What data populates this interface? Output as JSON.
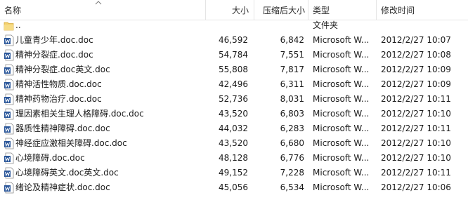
{
  "columns": {
    "name": "名称",
    "size": "大小",
    "compressed": "压缩后大小",
    "type": "类型",
    "modified": "修改时间"
  },
  "parent_row": {
    "name": "..",
    "type": "文件夹",
    "icon": "folder-icon"
  },
  "files": [
    {
      "name": "儿童青少年.doc.doc",
      "size": "46,592",
      "compressed": "6,842",
      "type": "Microsoft W...",
      "modified": "2012/2/27 10:07",
      "icon": "word-document-icon"
    },
    {
      "name": "精神分裂症.doc.doc",
      "size": "54,784",
      "compressed": "7,551",
      "type": "Microsoft W...",
      "modified": "2012/2/27 10:08",
      "icon": "word-document-icon"
    },
    {
      "name": "精神分裂症.doc英文.doc",
      "size": "55,808",
      "compressed": "7,817",
      "type": "Microsoft W...",
      "modified": "2012/2/27 10:09",
      "icon": "word-document-icon"
    },
    {
      "name": "精神活性物质.doc.doc",
      "size": "42,496",
      "compressed": "6,311",
      "type": "Microsoft W...",
      "modified": "2012/2/27 10:09",
      "icon": "word-document-icon"
    },
    {
      "name": "精神药物治疗.doc.doc",
      "size": "52,736",
      "compressed": "8,031",
      "type": "Microsoft W...",
      "modified": "2012/2/27 10:11",
      "icon": "word-document-icon"
    },
    {
      "name": "理因素相关生理人格障碍.doc.doc",
      "size": "43,520",
      "compressed": "6,803",
      "type": "Microsoft W...",
      "modified": "2012/2/27 10:10",
      "icon": "word-document-icon"
    },
    {
      "name": "器质性精神障碍.doc.doc",
      "size": "44,032",
      "compressed": "6,283",
      "type": "Microsoft W...",
      "modified": "2012/2/27 10:11",
      "icon": "word-document-icon"
    },
    {
      "name": "神经症应激相关障碍.doc.doc",
      "size": "43,520",
      "compressed": "6,680",
      "type": "Microsoft W...",
      "modified": "2012/2/27 10:10",
      "icon": "word-document-icon"
    },
    {
      "name": "心境障碍.doc.doc",
      "size": "48,128",
      "compressed": "6,776",
      "type": "Microsoft W...",
      "modified": "2012/2/27 10:10",
      "icon": "word-document-icon"
    },
    {
      "name": "心境障碍英文.doc英文.doc",
      "size": "49,152",
      "compressed": "7,228",
      "type": "Microsoft W...",
      "modified": "2012/2/27 10:11",
      "icon": "word-document-icon"
    },
    {
      "name": "绪论及精神症状.doc.doc",
      "size": "45,056",
      "compressed": "6,534",
      "type": "Microsoft W...",
      "modified": "2012/2/27 10:06",
      "icon": "word-document-icon"
    }
  ],
  "colors": {
    "folder": "#e8c15a",
    "word_blue": "#2b579a",
    "separator": "#e5e5e5"
  }
}
